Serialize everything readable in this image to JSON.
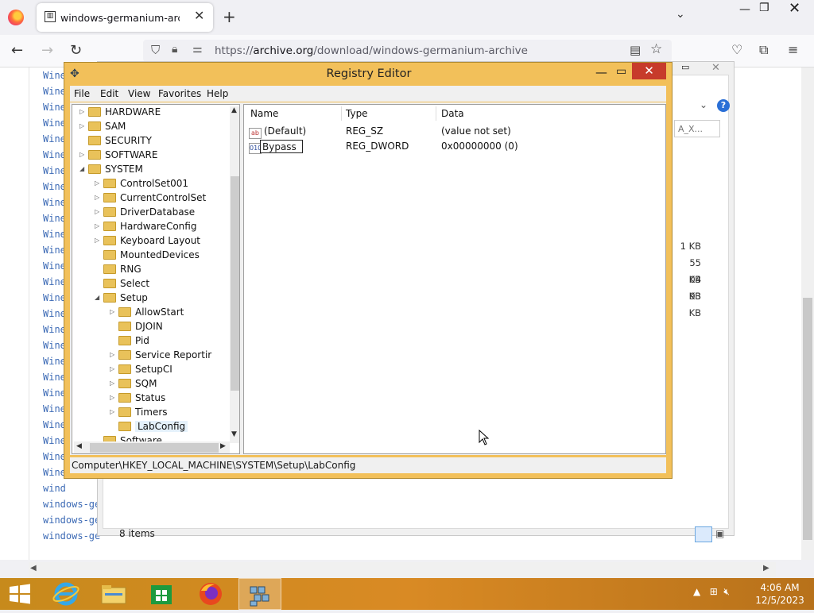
{
  "browser": {
    "tab_title": "windows-germanium-archive d",
    "tab_favicon": "archive-icon",
    "url_prefix": "https://",
    "url_domain": "archive.org",
    "url_path": "/download/windows-germanium-archive"
  },
  "page": {
    "links": [
      "Wine",
      "Wine",
      "Wine",
      "Wine",
      "Wine",
      "Wine",
      "Wine",
      "Wine",
      "Wine",
      "Wine",
      "Wine",
      "Wine",
      "Wine",
      "Wine",
      "Wine",
      "Wine",
      "Wine",
      "Wine",
      "Wine",
      "Wine",
      "Wine",
      "Wine",
      "Wine",
      "Wine",
      "Wine",
      "Wine",
      "wind",
      "windows-ge",
      "windows-ge",
      "windows-ge"
    ]
  },
  "explorer_dialog": {
    "search_placeholder": "A_X...",
    "sizes": [
      "1 KB",
      "55 KB",
      "04 KB",
      "93 KB"
    ],
    "status": "8 items"
  },
  "regedit": {
    "title": "Registry Editor",
    "menu": [
      "File",
      "Edit",
      "View",
      "Favorites",
      "Help"
    ],
    "tree": [
      {
        "label": "HARDWARE",
        "level": 0,
        "expander": "closed"
      },
      {
        "label": "SAM",
        "level": 0,
        "expander": "closed"
      },
      {
        "label": "SECURITY",
        "level": 0,
        "expander": "none"
      },
      {
        "label": "SOFTWARE",
        "level": 0,
        "expander": "closed"
      },
      {
        "label": "SYSTEM",
        "level": 0,
        "expander": "open"
      },
      {
        "label": "ControlSet001",
        "level": 1,
        "expander": "closed"
      },
      {
        "label": "CurrentControlSet",
        "level": 1,
        "expander": "closed"
      },
      {
        "label": "DriverDatabase",
        "level": 1,
        "expander": "closed"
      },
      {
        "label": "HardwareConfig",
        "level": 1,
        "expander": "closed"
      },
      {
        "label": "Keyboard Layout",
        "level": 1,
        "expander": "closed"
      },
      {
        "label": "MountedDevices",
        "level": 1,
        "expander": "none"
      },
      {
        "label": "RNG",
        "level": 1,
        "expander": "none"
      },
      {
        "label": "Select",
        "level": 1,
        "expander": "none"
      },
      {
        "label": "Setup",
        "level": 1,
        "expander": "open"
      },
      {
        "label": "AllowStart",
        "level": 2,
        "expander": "closed"
      },
      {
        "label": "DJOIN",
        "level": 2,
        "expander": "none"
      },
      {
        "label": "Pid",
        "level": 2,
        "expander": "none"
      },
      {
        "label": "Service Reportir",
        "level": 2,
        "expander": "closed"
      },
      {
        "label": "SetupCI",
        "level": 2,
        "expander": "closed"
      },
      {
        "label": "SQM",
        "level": 2,
        "expander": "closed"
      },
      {
        "label": "Status",
        "level": 2,
        "expander": "closed"
      },
      {
        "label": "Timers",
        "level": 2,
        "expander": "closed"
      },
      {
        "label": "LabConfig",
        "level": 2,
        "expander": "none",
        "selected": true
      },
      {
        "label": "Software",
        "level": 1,
        "expander": "none"
      }
    ],
    "columns": {
      "name": "Name",
      "type": "Type",
      "data": "Data"
    },
    "values": [
      {
        "name": "(Default)",
        "type": "REG_SZ",
        "data": "(value not set)",
        "icon": "ab"
      },
      {
        "name": "Bypass",
        "type": "REG_DWORD",
        "data": "0x00000000 (0)",
        "icon": "010",
        "editing": true
      }
    ],
    "status_path": "Computer\\HKEY_LOCAL_MACHINE\\SYSTEM\\Setup\\LabConfig"
  },
  "taskbar": {
    "time": "4:06 AM",
    "date": "12/5/2023"
  },
  "colors": {
    "regedit_frame": "#f2c05a",
    "close_red": "#c73b2b",
    "taskbar": "#d98a24",
    "link_blue": "#3c6ab5"
  }
}
